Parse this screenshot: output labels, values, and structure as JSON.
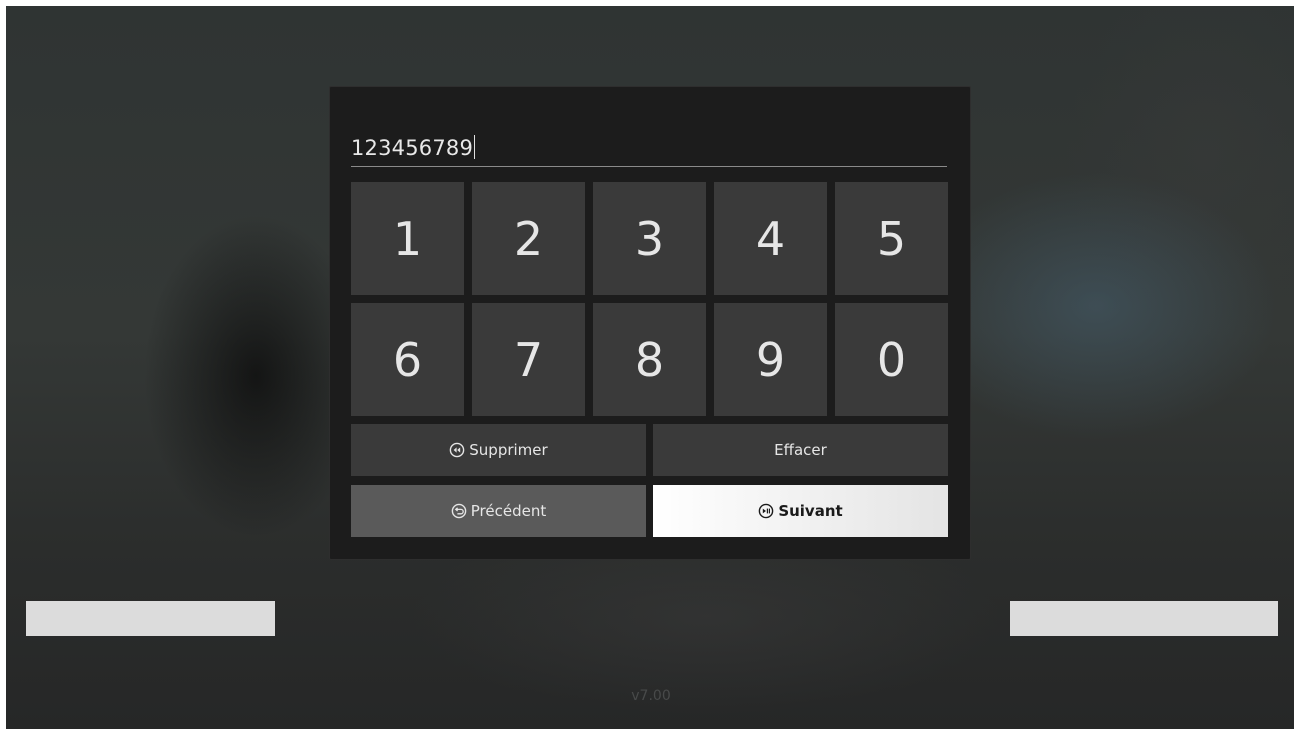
{
  "entry": {
    "value": "123456789"
  },
  "keypad": {
    "row1": [
      "1",
      "2",
      "3",
      "4",
      "5"
    ],
    "row2": [
      "6",
      "7",
      "8",
      "9",
      "0"
    ]
  },
  "actions": {
    "delete_label": "Supprimer",
    "delete_icon": "rewind-circle-icon",
    "clear_label": "Effacer",
    "previous_label": "Précédent",
    "previous_icon": "back-circle-icon",
    "next_label": "Suivant",
    "next_icon": "play-pause-circle-icon"
  },
  "footer": {
    "version": "v7.00"
  },
  "colors": {
    "dialog_bg": "#1c1c1c",
    "key_bg": "#3a3a3a",
    "focused_button_bg": "#ffffff",
    "previous_button_bg": "#5a5a5a"
  }
}
